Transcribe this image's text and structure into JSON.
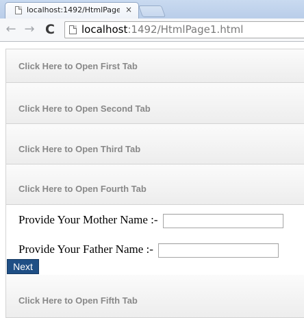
{
  "browser": {
    "tab": {
      "title": "localhost:1492/HtmlPage1",
      "close_glyph": "×",
      "icon": "page-icon"
    },
    "address_bar": {
      "url_host": "localhost",
      "url_rest": ":1492/HtmlPage1.html",
      "icon": "page-icon"
    },
    "nav": {
      "back_glyph": "←",
      "forward_glyph": "→",
      "reload_glyph": "C"
    }
  },
  "accordion": {
    "headers": [
      "Click Here to Open First Tab",
      "Click Here to Open Second Tab",
      "Click Here to Open Third Tab",
      "Click Here to Open Fourth Tab",
      "Click Here to Open Fifth Tab"
    ],
    "open_panel": {
      "mother_label": "Provide Your Mother Name :-",
      "mother_value": "",
      "father_label": "Provide Your Father Name :-",
      "father_value": "",
      "next_label": "Next"
    }
  },
  "colors": {
    "header_text": "#888888",
    "next_button_bg": "#1f4f85",
    "next_button_text": "#ffffff",
    "tabstrip_bg": "#c9daf0"
  }
}
